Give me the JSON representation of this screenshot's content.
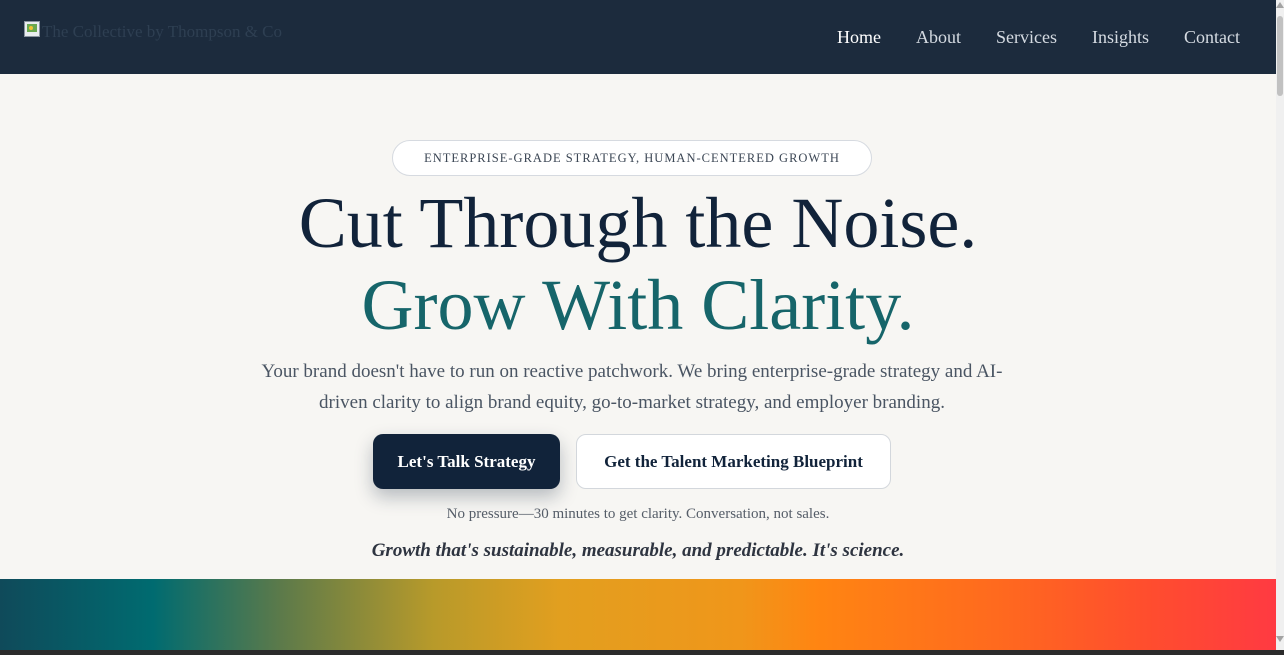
{
  "nav": {
    "logo_alt": "The Collective by Thompson & Co",
    "links": [
      "Home",
      "About",
      "Services",
      "Insights",
      "Contact"
    ],
    "active": "Home"
  },
  "hero": {
    "eyebrow": "ENTERPRISE-GRADE STRATEGY, HUMAN-CENTERED GROWTH",
    "headline_line1": "Cut Through the Noise.",
    "headline_line2": "Grow With Clarity.",
    "subtext": "Your brand doesn't have to run on reactive patchwork. We bring enterprise-grade strategy and AI-driven clarity to align brand equity, go-to-market strategy, and employer branding.",
    "primary_cta": "Let's Talk Strategy",
    "secondary_cta": "Get the Talent Marketing Blueprint",
    "note": "No pressure—30 minutes to get clarity. Conversation, not sales.",
    "tagline": "Growth that's sustainable, measurable, and predictable. It's science."
  },
  "colors": {
    "nav_bg": "#1c2b3d",
    "page_bg": "#f7f6f3",
    "navy": "#11233a",
    "teal": "#16656a",
    "gradient": [
      "#0f4a5a",
      "#006b70",
      "#e29f1f",
      "#ff8512",
      "#ff3a42"
    ]
  }
}
